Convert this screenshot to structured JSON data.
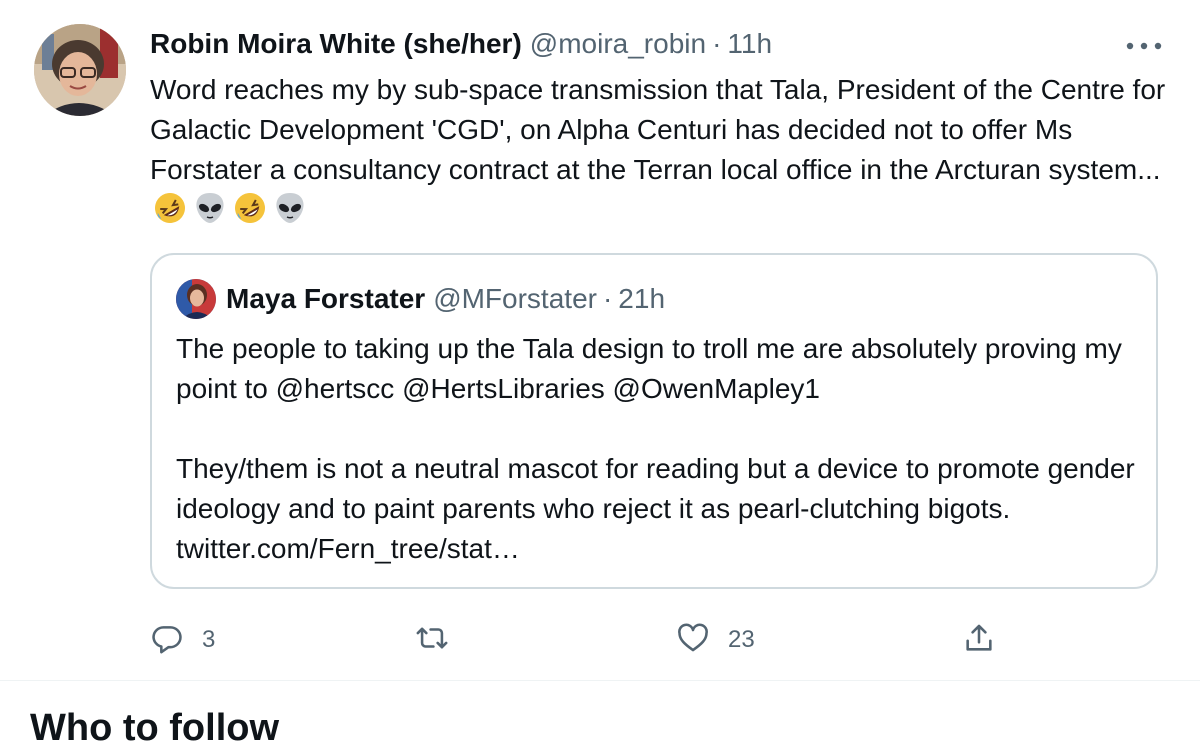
{
  "tweet": {
    "author_name": "Robin Moira White (she/her)",
    "handle": "@moira_robin",
    "separator": "·",
    "time": "11h",
    "text": "Word reaches my by sub-space transmission that Tala, President of the Centre for Galactic Development 'CGD', on Alpha Centuri has decided not to offer Ms Forstater a consultancy contract at the Terran local office in the Arcturan system...",
    "emojis": [
      "rolling-on-floor-laughing",
      "alien",
      "rolling-on-floor-laughing",
      "alien"
    ]
  },
  "quoted_tweet": {
    "author_name": "Maya Forstater",
    "handle": "@MForstater",
    "separator": "·",
    "time": "21h",
    "paragraph_1": "The people to taking up the Tala design to troll me are absolutely proving my point to @hertscc @HertsLibraries @OwenMapley1",
    "paragraph_2": "They/them is not a neutral mascot for reading but a device to promote gender ideology and to paint parents who reject it as pearl-clutching bigots. twitter.com/Fern_tree/stat…"
  },
  "actions": {
    "reply_count": "3",
    "retweet_count": "",
    "like_count": "23",
    "icons": [
      "reply-icon",
      "retweet-icon",
      "like-icon",
      "share-icon"
    ]
  },
  "sidebar": {
    "who_to_follow": "Who to follow"
  },
  "colors": {
    "text": "#0f1419",
    "secondary": "#536471",
    "border": "#cfd9de",
    "divider": "#eff3f4"
  }
}
